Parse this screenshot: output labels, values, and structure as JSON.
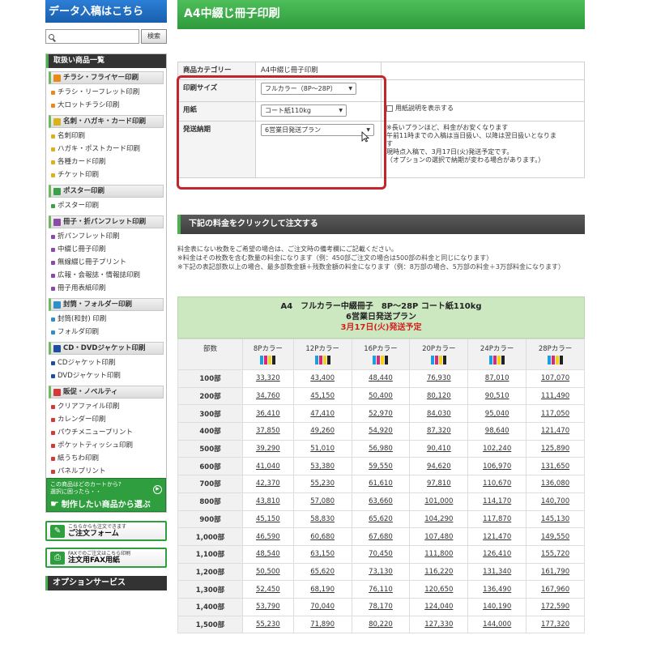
{
  "sidebar": {
    "upload_banner": "データ入稿はこちら",
    "search_placeholder": "",
    "search_button": "検索",
    "menu_title": "取扱い商品一覧",
    "categories": [
      {
        "label": "チラシ・フライヤー印刷",
        "color": "#e8891c",
        "items": [
          "チラシ・リーフレット印刷",
          "大ロットチラシ印刷"
        ]
      },
      {
        "label": "名刺・ハガキ・カード印刷",
        "color": "#d9b21c",
        "items": [
          "名刺印刷",
          "ハガキ・ポストカード印刷",
          "各種カード印刷",
          "チケット印刷"
        ]
      },
      {
        "label": "ポスター印刷",
        "color": "#3ca04a",
        "items": [
          "ポスター印刷"
        ]
      },
      {
        "label": "冊子・折パンフレット印刷",
        "color": "#8a4ca8",
        "items": [
          "折パンフレット印刷",
          "中綴じ冊子印刷",
          "無線綴じ冊子プリント",
          "広報・会報誌・情報誌印刷",
          "冊子用表紙印刷"
        ]
      },
      {
        "label": "封筒・フォルダー印刷",
        "color": "#2f8fc8",
        "items": [
          "封筒(和封) 印刷",
          "フォルダ印刷"
        ]
      },
      {
        "label": "CD・DVDジャケット印刷",
        "color": "#1c4fa0",
        "items": [
          "CDジャケット印刷",
          "DVDジャケット印刷"
        ]
      },
      {
        "label": "販促・ノベルティ",
        "color": "#d23a3a",
        "items": [
          "クリアファイル印刷",
          "カレンダー印刷",
          "パウチメニュープリント",
          "ポケットティッシュ印刷",
          "紙うちわ印刷",
          "パネルプリント"
        ]
      }
    ],
    "green_box_small": "この商品はどのカートから?\n選択に困ったら・・",
    "green_box_big": "制作したい商品から選ぶ",
    "order_form_small": "こちらからも注文できます",
    "order_form_label": "ご注文フォーム",
    "fax_form_small": "FAXでのご注文はこちら印刷",
    "fax_form_label": "注文用FAX用紙",
    "options_title": "オプションサービス"
  },
  "main": {
    "title": "A4中綴じ冊子印刷",
    "spec": {
      "category_label": "商品カテゴリー",
      "category_value": "A4中綴じ冊子印刷",
      "size_label": "印刷サイズ",
      "size_value": "フルカラー（8P〜28P）",
      "paper_label": "用紙",
      "paper_value": "コート紙110kg",
      "paper_desc_label": "用紙説明を表示する",
      "delivery_label": "発送納期",
      "delivery_value": "6営業日発送プラン",
      "delivery_notes": [
        "※長いプランほど、料金がお安くなります",
        "午前11時までの入稿は当日扱い、以降は翌日扱いとなりま",
        "す",
        "現時点入稿で、3月17日(火)発送予定です。",
        "（オプションの選択で納期が変わる場合があります。）"
      ]
    },
    "order_bar": "下記の料金をクリックして注文する",
    "notes": [
      "料金表にない枚数をご希望の場合は、ご注文時の備考欄にご記載ください。",
      "※料金はその枚数を含む数量の料金になります（例：450部ご注文の場合は500部の料金と同じになります）",
      "※下記の表記部数以上の場合、最多部数金額＋残数金額の料金になります（例：8万部の場合、5万部の料金＋3万部料金になります）"
    ],
    "price_header": {
      "line1": "A4　フルカラー中綴冊子　8P〜28P コート紙110kg",
      "line2": "6営業日発送プラン",
      "line3": "3月17日(火)発送予定"
    },
    "table": {
      "qty_header": "部数",
      "columns": [
        "8Pカラー",
        "12Pカラー",
        "16Pカラー",
        "20Pカラー",
        "24Pカラー",
        "28Pカラー"
      ],
      "rows": [
        {
          "qty": "100部",
          "prices": [
            "33,320",
            "43,400",
            "48,440",
            "76,930",
            "87,010",
            "107,070"
          ]
        },
        {
          "qty": "200部",
          "prices": [
            "34,760",
            "45,150",
            "50,400",
            "80,120",
            "90,510",
            "111,490"
          ]
        },
        {
          "qty": "300部",
          "prices": [
            "36,410",
            "47,410",
            "52,970",
            "84,030",
            "95,040",
            "117,050"
          ]
        },
        {
          "qty": "400部",
          "prices": [
            "37,850",
            "49,260",
            "54,920",
            "87,320",
            "98,640",
            "121,470"
          ]
        },
        {
          "qty": "500部",
          "prices": [
            "39,290",
            "51,010",
            "56,980",
            "90,410",
            "102,240",
            "125,890"
          ]
        },
        {
          "qty": "600部",
          "prices": [
            "41,040",
            "53,380",
            "59,550",
            "94,620",
            "106,970",
            "131,650"
          ]
        },
        {
          "qty": "700部",
          "prices": [
            "42,370",
            "55,230",
            "61,610",
            "97,810",
            "110,670",
            "136,080"
          ]
        },
        {
          "qty": "800部",
          "prices": [
            "43,810",
            "57,080",
            "63,660",
            "101,000",
            "114,170",
            "140,700"
          ]
        },
        {
          "qty": "900部",
          "prices": [
            "45,150",
            "58,830",
            "65,620",
            "104,290",
            "117,870",
            "145,130"
          ]
        },
        {
          "qty": "1,000部",
          "prices": [
            "46,590",
            "60,680",
            "67,680",
            "107,480",
            "121,470",
            "149,550"
          ]
        },
        {
          "qty": "1,100部",
          "prices": [
            "48,540",
            "63,150",
            "70,450",
            "111,800",
            "126,410",
            "155,720"
          ]
        },
        {
          "qty": "1,200部",
          "prices": [
            "50,500",
            "65,620",
            "73,130",
            "116,220",
            "131,340",
            "161,790"
          ]
        },
        {
          "qty": "1,300部",
          "prices": [
            "52,450",
            "68,190",
            "76,110",
            "120,650",
            "136,490",
            "167,960"
          ]
        },
        {
          "qty": "1,400部",
          "prices": [
            "53,790",
            "70,040",
            "78,170",
            "124,040",
            "140,190",
            "172,590"
          ]
        },
        {
          "qty": "1,500部",
          "prices": [
            "55,230",
            "71,890",
            "80,220",
            "127,330",
            "144,000",
            "177,320"
          ]
        }
      ]
    }
  },
  "colors": {
    "brand_green": "#2f9a3c",
    "highlight_red": "#c0262c",
    "header_dark": "#333333",
    "price_head_bg": "#cce8c0"
  }
}
